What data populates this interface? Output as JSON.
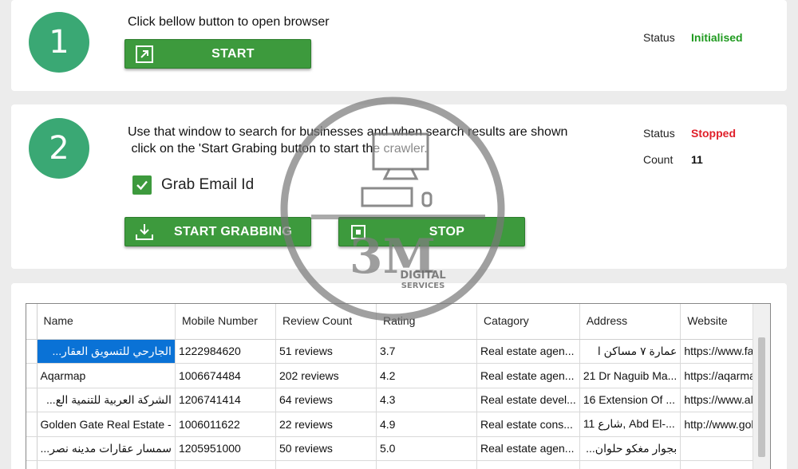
{
  "step1": {
    "number": "1",
    "instruction": "Click bellow button to open browser",
    "start_label": "START",
    "status_label": "Status",
    "status_value": "Initialised"
  },
  "step2": {
    "number": "2",
    "instruction_line1": "Use that window to search for businesses and when search results are shown",
    "instruction_line2": " click on the 'Start Grabing button to start the crawler.",
    "grab_email_label": "Grab Email Id",
    "grab_email_checked": true,
    "start_grabbing_label": "START GRABBING",
    "stop_label": "STOP",
    "status_label": "Status",
    "status_value": "Stopped",
    "count_label": "Count",
    "count_value": "11"
  },
  "colors": {
    "accent_green": "#3d9a3d",
    "circle_green": "#3aa874",
    "status_initialised": "#1f9a1f",
    "status_stopped": "#e0202a",
    "selection_blue": "#0a72d6"
  },
  "watermark": {
    "brand": "3M",
    "line1": "DIGITAL",
    "line2": "SERVICES"
  },
  "table": {
    "headers": [
      "Name",
      "Mobile Number",
      "Review Count",
      "Rating",
      "Catagory",
      "Address",
      "Website"
    ],
    "rows": [
      [
        "الجارحي للتسويق العقار...",
        "1222984620",
        "51 reviews",
        "3.7",
        "Real estate agen...",
        "عمارة ٧ مساكن ا",
        "https://www.fac"
      ],
      [
        "Aqarmap",
        "1006674484",
        "202 reviews",
        "4.2",
        "Real estate agen...",
        "21 Dr Naguib Ma...",
        "https://aqarmap"
      ],
      [
        "الشركة العربية للتنمية الع...",
        "1206741414",
        "64 reviews",
        "4.3",
        "Real estate devel...",
        "16 Extension Of ...",
        "https://www.ala"
      ],
      [
        "Golden Gate Real Estate -",
        "1006011622",
        "22 reviews",
        "4.9",
        "Real estate cons...",
        "11 شارع, Abd El-...",
        "http://www.golc"
      ],
      [
        "سمسار عقارات مدينه نصر...",
        "1205951000",
        "50 reviews",
        "5.0",
        "Real estate agen...",
        "بجوار مغكو حلوان...",
        ""
      ]
    ]
  }
}
